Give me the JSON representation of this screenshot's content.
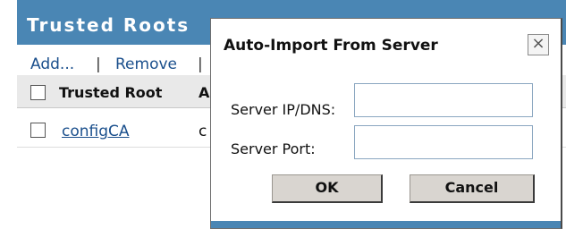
{
  "panel": {
    "title": "Trusted Roots",
    "toolbar": {
      "add_label": "Add...",
      "separator1": "|",
      "remove_label": "Remove",
      "separator2": "|"
    },
    "columns": [
      "Trusted Root",
      "A"
    ],
    "rows": [
      {
        "name": "configCA",
        "second_col": "c"
      }
    ],
    "colors": {
      "header_bg": "#4a86b4",
      "link": "#1a4f8c"
    }
  },
  "dialog": {
    "title": "Auto-Import From Server",
    "close_glyph": "×",
    "fields": [
      {
        "label": "Server IP/DNS:",
        "value": "",
        "placeholder": ""
      },
      {
        "label": "Server Port:",
        "value": "",
        "placeholder": ""
      }
    ],
    "buttons": {
      "ok_label": "OK",
      "cancel_label": "Cancel"
    },
    "icons": {
      "close": "close-icon"
    }
  }
}
